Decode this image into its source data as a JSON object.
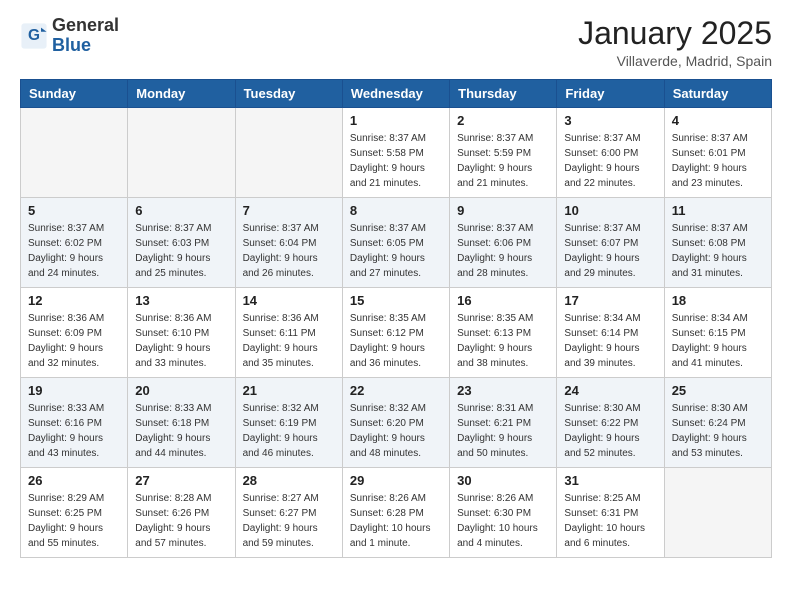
{
  "logo": {
    "general": "General",
    "blue": "Blue"
  },
  "header": {
    "month": "January 2025",
    "location": "Villaverde, Madrid, Spain"
  },
  "weekdays": [
    "Sunday",
    "Monday",
    "Tuesday",
    "Wednesday",
    "Thursday",
    "Friday",
    "Saturday"
  ],
  "weeks": [
    [
      {
        "day": "",
        "info": ""
      },
      {
        "day": "",
        "info": ""
      },
      {
        "day": "",
        "info": ""
      },
      {
        "day": "1",
        "info": "Sunrise: 8:37 AM\nSunset: 5:58 PM\nDaylight: 9 hours\nand 21 minutes."
      },
      {
        "day": "2",
        "info": "Sunrise: 8:37 AM\nSunset: 5:59 PM\nDaylight: 9 hours\nand 21 minutes."
      },
      {
        "day": "3",
        "info": "Sunrise: 8:37 AM\nSunset: 6:00 PM\nDaylight: 9 hours\nand 22 minutes."
      },
      {
        "day": "4",
        "info": "Sunrise: 8:37 AM\nSunset: 6:01 PM\nDaylight: 9 hours\nand 23 minutes."
      }
    ],
    [
      {
        "day": "5",
        "info": "Sunrise: 8:37 AM\nSunset: 6:02 PM\nDaylight: 9 hours\nand 24 minutes."
      },
      {
        "day": "6",
        "info": "Sunrise: 8:37 AM\nSunset: 6:03 PM\nDaylight: 9 hours\nand 25 minutes."
      },
      {
        "day": "7",
        "info": "Sunrise: 8:37 AM\nSunset: 6:04 PM\nDaylight: 9 hours\nand 26 minutes."
      },
      {
        "day": "8",
        "info": "Sunrise: 8:37 AM\nSunset: 6:05 PM\nDaylight: 9 hours\nand 27 minutes."
      },
      {
        "day": "9",
        "info": "Sunrise: 8:37 AM\nSunset: 6:06 PM\nDaylight: 9 hours\nand 28 minutes."
      },
      {
        "day": "10",
        "info": "Sunrise: 8:37 AM\nSunset: 6:07 PM\nDaylight: 9 hours\nand 29 minutes."
      },
      {
        "day": "11",
        "info": "Sunrise: 8:37 AM\nSunset: 6:08 PM\nDaylight: 9 hours\nand 31 minutes."
      }
    ],
    [
      {
        "day": "12",
        "info": "Sunrise: 8:36 AM\nSunset: 6:09 PM\nDaylight: 9 hours\nand 32 minutes."
      },
      {
        "day": "13",
        "info": "Sunrise: 8:36 AM\nSunset: 6:10 PM\nDaylight: 9 hours\nand 33 minutes."
      },
      {
        "day": "14",
        "info": "Sunrise: 8:36 AM\nSunset: 6:11 PM\nDaylight: 9 hours\nand 35 minutes."
      },
      {
        "day": "15",
        "info": "Sunrise: 8:35 AM\nSunset: 6:12 PM\nDaylight: 9 hours\nand 36 minutes."
      },
      {
        "day": "16",
        "info": "Sunrise: 8:35 AM\nSunset: 6:13 PM\nDaylight: 9 hours\nand 38 minutes."
      },
      {
        "day": "17",
        "info": "Sunrise: 8:34 AM\nSunset: 6:14 PM\nDaylight: 9 hours\nand 39 minutes."
      },
      {
        "day": "18",
        "info": "Sunrise: 8:34 AM\nSunset: 6:15 PM\nDaylight: 9 hours\nand 41 minutes."
      }
    ],
    [
      {
        "day": "19",
        "info": "Sunrise: 8:33 AM\nSunset: 6:16 PM\nDaylight: 9 hours\nand 43 minutes."
      },
      {
        "day": "20",
        "info": "Sunrise: 8:33 AM\nSunset: 6:18 PM\nDaylight: 9 hours\nand 44 minutes."
      },
      {
        "day": "21",
        "info": "Sunrise: 8:32 AM\nSunset: 6:19 PM\nDaylight: 9 hours\nand 46 minutes."
      },
      {
        "day": "22",
        "info": "Sunrise: 8:32 AM\nSunset: 6:20 PM\nDaylight: 9 hours\nand 48 minutes."
      },
      {
        "day": "23",
        "info": "Sunrise: 8:31 AM\nSunset: 6:21 PM\nDaylight: 9 hours\nand 50 minutes."
      },
      {
        "day": "24",
        "info": "Sunrise: 8:30 AM\nSunset: 6:22 PM\nDaylight: 9 hours\nand 52 minutes."
      },
      {
        "day": "25",
        "info": "Sunrise: 8:30 AM\nSunset: 6:24 PM\nDaylight: 9 hours\nand 53 minutes."
      }
    ],
    [
      {
        "day": "26",
        "info": "Sunrise: 8:29 AM\nSunset: 6:25 PM\nDaylight: 9 hours\nand 55 minutes."
      },
      {
        "day": "27",
        "info": "Sunrise: 8:28 AM\nSunset: 6:26 PM\nDaylight: 9 hours\nand 57 minutes."
      },
      {
        "day": "28",
        "info": "Sunrise: 8:27 AM\nSunset: 6:27 PM\nDaylight: 9 hours\nand 59 minutes."
      },
      {
        "day": "29",
        "info": "Sunrise: 8:26 AM\nSunset: 6:28 PM\nDaylight: 10 hours\nand 1 minute."
      },
      {
        "day": "30",
        "info": "Sunrise: 8:26 AM\nSunset: 6:30 PM\nDaylight: 10 hours\nand 4 minutes."
      },
      {
        "day": "31",
        "info": "Sunrise: 8:25 AM\nSunset: 6:31 PM\nDaylight: 10 hours\nand 6 minutes."
      },
      {
        "day": "",
        "info": ""
      }
    ]
  ]
}
